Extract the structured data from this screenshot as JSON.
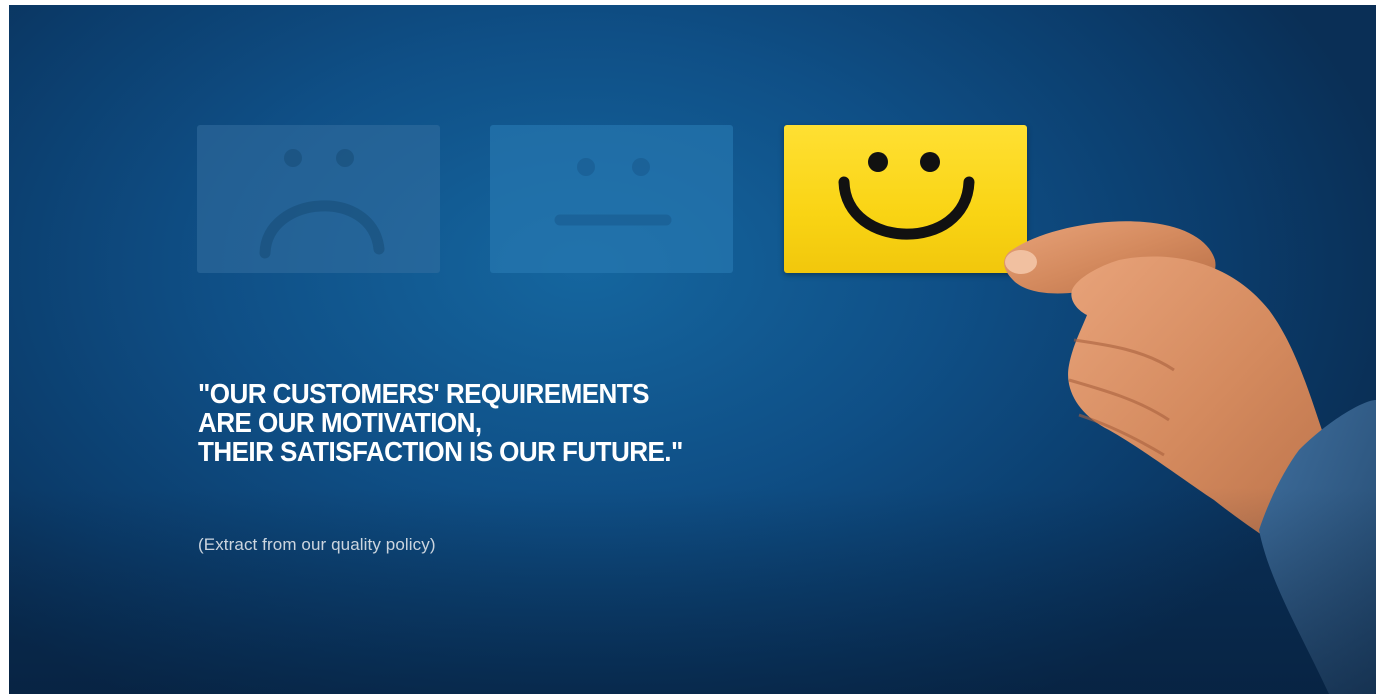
{
  "quote": {
    "line1": "\"OUR CUSTOMERS' REQUIREMENTS",
    "line2": "ARE OUR MOTIVATION,",
    "line3": "THEIR SATISFACTION IS OUR FUTURE.\""
  },
  "source": "(Extract from our quality policy)",
  "cards": [
    {
      "icon": "sad-face-icon",
      "color": "#3a7aad"
    },
    {
      "icon": "neutral-face-icon",
      "color": "#2b86c0"
    },
    {
      "icon": "smiley-face-icon",
      "color": "#f7d316"
    }
  ],
  "colors": {
    "background": "#0f4f86",
    "text": "#ffffff",
    "smiley_card": "#f7d316"
  }
}
